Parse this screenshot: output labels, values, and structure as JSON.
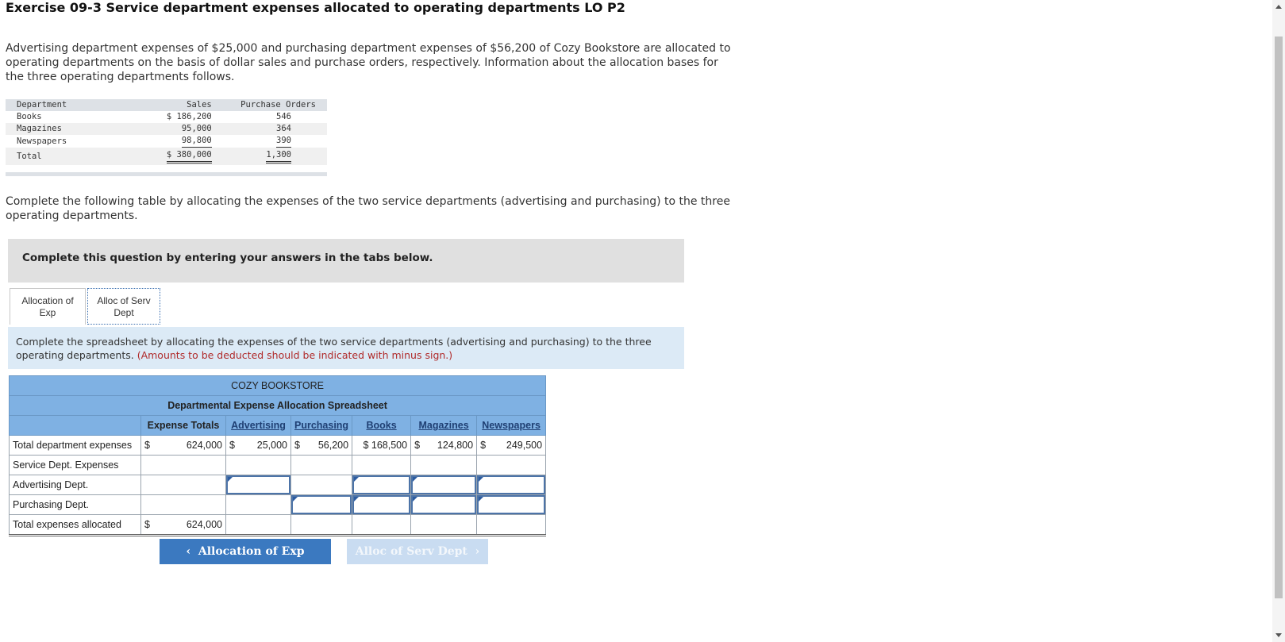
{
  "title": "Exercise 09-3 Service department expenses allocated to operating departments LO P2",
  "intro": "Advertising department expenses of $25,000 and purchasing department expenses of $56,200 of Cozy Bookstore are allocated to operating departments on the basis of dollar sales and purchase orders, respectively. Information about the allocation bases for the three operating departments follows.",
  "basis_table": {
    "headers": [
      "Department",
      "Sales",
      "Purchase Orders"
    ],
    "rows": [
      {
        "dept": "Books",
        "sales": "$ 186,200",
        "po": "546"
      },
      {
        "dept": "Magazines",
        "sales": "95,000",
        "po": "364"
      },
      {
        "dept": "Newspapers",
        "sales": "98,800",
        "po": "390"
      }
    ],
    "total": {
      "dept": "Total",
      "sales": "$ 380,000",
      "po": "1,300"
    }
  },
  "para2": "Complete the following table by allocating the expenses of the two service departments (advertising and purchasing) to the three operating departments.",
  "gray_box": "Complete this question by entering your answers in the tabs below.",
  "tabs": [
    {
      "label1": "Allocation of",
      "label2": "Exp"
    },
    {
      "label1": "Alloc of Serv",
      "label2": "Dept"
    }
  ],
  "instructions": {
    "text": "Complete the spreadsheet by allocating the expenses of the two service departments (advertising and purchasing) to the three operating departments.",
    "red": "(Amounts to be deducted should be indicated with minus sign.)"
  },
  "sheet": {
    "company": "COZY BOOKSTORE",
    "subtitle": "Departmental Expense Allocation Spreadsheet",
    "col_headers": [
      "Expense Totals",
      "Advertising",
      "Purchasing",
      "Books",
      "Magazines",
      "Newspapers"
    ],
    "rows": {
      "total_dept": {
        "label": "Total department expenses",
        "exp_cur": "$",
        "exp": "624,000",
        "adv_cur": "$",
        "adv": "25,000",
        "pur_cur": "$",
        "pur": "56,200",
        "books": "$ 168,500",
        "mag_cur": "$",
        "mag": "124,800",
        "news_cur": "$",
        "news": "249,500"
      },
      "service": {
        "label": "Service Dept. Expenses"
      },
      "advertising": {
        "label": "Advertising Dept."
      },
      "purchasing": {
        "label": "Purchasing Dept."
      },
      "total_alloc": {
        "label": "Total expenses allocated",
        "exp_cur": "$",
        "exp": "624,000"
      }
    }
  },
  "buttons": {
    "prev": "Allocation of Exp",
    "next": "Alloc of Serv Dept"
  },
  "colors": {
    "accent": "#3b79c0",
    "header_blue": "#7fb1e3",
    "instruction_bg": "#dceaf6"
  }
}
